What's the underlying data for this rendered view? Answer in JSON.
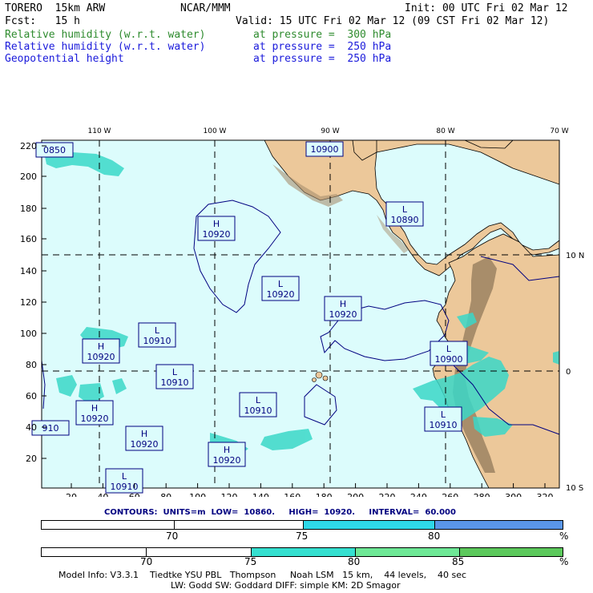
{
  "header": {
    "model": "TORERO  15km ARW",
    "center": "NCAR/MMM",
    "init": "Init: 00 UTC Fri 02 Mar 12",
    "fcst": "Fcst:   15 h",
    "valid": "Valid: 15 UTC Fri 02 Mar 12 (09 CST Fri 02 Mar 12)"
  },
  "fields": [
    {
      "name": "Relative humidity (w.r.t. water)",
      "level": "at pressure =  300 hPa",
      "color": "#2e8b2e"
    },
    {
      "name": "Relative humidity (w.r.t. water)",
      "level": "at pressure =  250 hPa",
      "color": "#1a1adb"
    },
    {
      "name": "Geopotential height",
      "level": "at pressure =  250 hPa",
      "color": "#1a1adb"
    }
  ],
  "map": {
    "lon_labels": [
      "110 W",
      "100 W",
      "90 W",
      "80 W",
      "70 W"
    ],
    "lat_labels": [
      "10 N",
      "0",
      "10 S"
    ],
    "y_ticks": [
      "220",
      "200",
      "180",
      "160",
      "140",
      "120",
      "100",
      "80",
      "60",
      "40",
      "20"
    ],
    "x_ticks": [
      "20",
      "40",
      "60",
      "80",
      "100",
      "120",
      "140",
      "160",
      "180",
      "200",
      "220",
      "240",
      "260",
      "280",
      "300",
      "320"
    ],
    "height_labels": [
      {
        "type": "H",
        "value": "10920"
      },
      {
        "type": "L",
        "value": "10920"
      },
      {
        "type": "H",
        "value": "10920"
      },
      {
        "type": "L",
        "value": "10910"
      },
      {
        "type": "H",
        "value": "10920"
      },
      {
        "type": "L",
        "value": "10910"
      },
      {
        "type": "L",
        "value": "10910"
      },
      {
        "type": "H",
        "value": "10920"
      },
      {
        "type": "H",
        "value": "10920"
      },
      {
        "type": "H",
        "value": "10920"
      },
      {
        "type": "L",
        "value": "10890"
      },
      {
        "type": "L",
        "value": "10900"
      },
      {
        "type": "L",
        "value": "10910"
      },
      {
        "type": "",
        "value": "10900"
      },
      {
        "type": "",
        "value": "0850"
      },
      {
        "type": "",
        "value": "910"
      },
      {
        "type": "L",
        "value": "10910"
      }
    ],
    "colors": {
      "ocean": "#dcfcfc",
      "land": "#ecc89a",
      "high_land": "#a89070",
      "humidity": "#3ad8c8",
      "contour": "#000080"
    }
  },
  "contours": {
    "units_label": "CONTOURS:  UNITS=m  LOW=  10860.     HIGH=  10920.     INTERVAL=  60.000"
  },
  "colorbar_250": {
    "labels": [
      "70",
      "75",
      "80",
      "%"
    ],
    "colors": [
      "#ffffff",
      "#ffffff",
      "#2ed8e8",
      "#5a96e8"
    ]
  },
  "colorbar_300": {
    "labels": [
      "70",
      "75",
      "80",
      "85",
      "%"
    ],
    "colors": [
      "#ffffff",
      "#ffffff",
      "#35e0d0",
      "#6ee896",
      "#5cc95c"
    ]
  },
  "footer": {
    "line1": "Model Info: V3.3.1    Tiedtke YSU PBL   Thompson     Noah LSM   15 km,    44 levels,    40 sec",
    "line2": "LW: Godd SW: Goddard DIFF: simple KM: 2D Smagor"
  }
}
